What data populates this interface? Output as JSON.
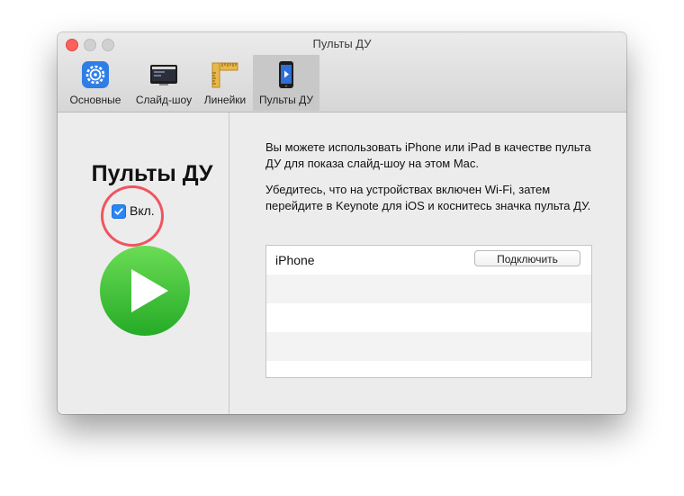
{
  "window": {
    "title": "Пульты ДУ"
  },
  "toolbar": {
    "tabs": [
      {
        "label": "Основные",
        "icon": "gear-icon"
      },
      {
        "label": "Слайд-шоу",
        "icon": "slideshow-display-icon"
      },
      {
        "label": "Линейки",
        "icon": "ruler-icon"
      },
      {
        "label": "Пульты ДУ",
        "icon": "iphone-remote-icon",
        "active": true
      }
    ]
  },
  "left_panel": {
    "heading": "Пульты ДУ",
    "enable_checkbox": {
      "label": "Вкл.",
      "checked": true
    },
    "annotation_color": "#ef5560",
    "play_icon": "play-icon"
  },
  "right_panel": {
    "description_1": "Вы можете использовать iPhone или iPad в качестве пульта ДУ для показа слайд-шоу на этом Mac.",
    "description_2": "Убедитесь, что на устройствах включен Wi-Fi, затем перейдите в Keynote для iOS и коснитесь значка пульта ДУ.",
    "devices": [
      {
        "name": "iPhone",
        "action": "Подключить"
      }
    ]
  },
  "colors": {
    "accent": "#2a86f5",
    "play_green": "#3ec437",
    "close_red": "#fc615d"
  }
}
